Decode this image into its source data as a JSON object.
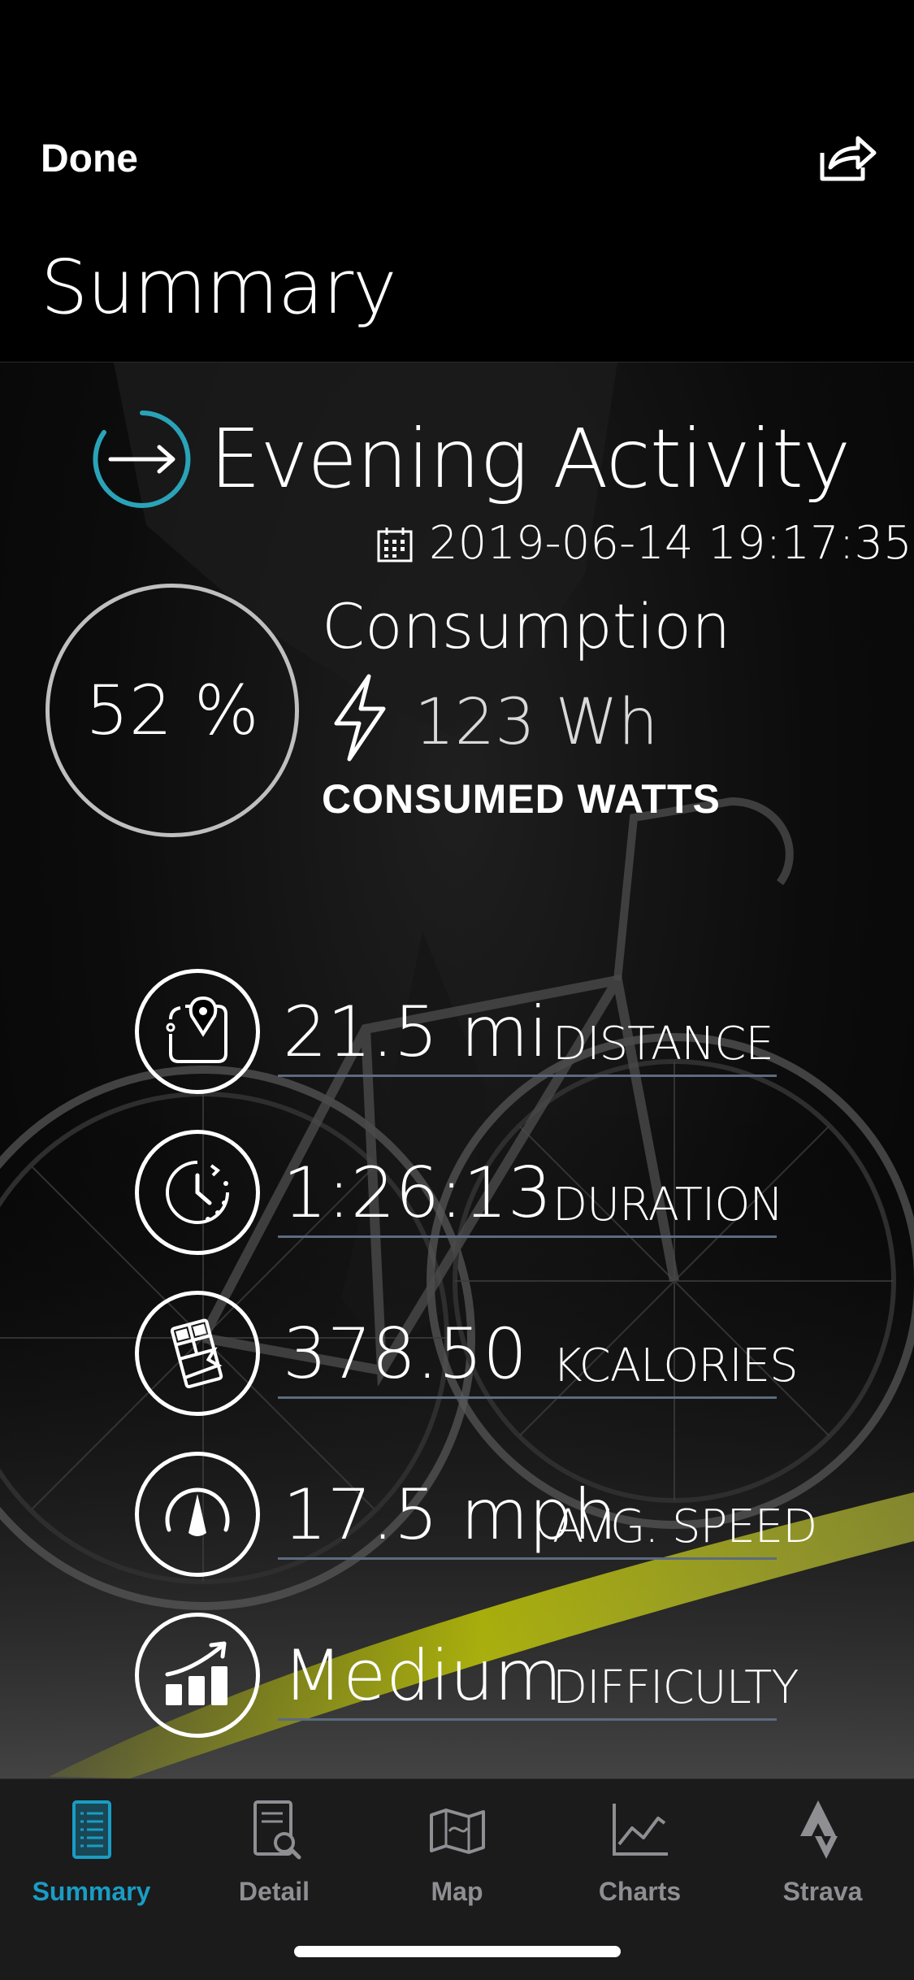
{
  "nav": {
    "done_label": "Done",
    "share_icon": "share-icon",
    "title": "Summary"
  },
  "activity": {
    "title": "Evening Activity",
    "date": "2019-06-14 19:17:35",
    "icon": "arrow-right-circle-icon"
  },
  "consumption": {
    "percent": "52 %",
    "label": "Consumption",
    "value": "123 Wh",
    "caption": "CONSUMED WATTS"
  },
  "stats": [
    {
      "value": "21.5 mi",
      "label": "DISTANCE",
      "icon": "map-pin-icon"
    },
    {
      "value": "1:26:13",
      "label": "DURATION",
      "icon": "stopwatch-icon"
    },
    {
      "value": "378.50",
      "label": "KCALORIES",
      "icon": "chocolate-bar-icon"
    },
    {
      "value": "17.5 mph",
      "label": "AVG. SPEED",
      "icon": "speedometer-icon"
    },
    {
      "value": "Medium",
      "label": "DIFFICULTY",
      "icon": "difficulty-chart-icon"
    }
  ],
  "tabs": [
    {
      "label": "Summary",
      "icon": "summary-list-icon",
      "active": true
    },
    {
      "label": "Detail",
      "icon": "detail-search-icon",
      "active": false
    },
    {
      "label": "Map",
      "icon": "map-icon",
      "active": false
    },
    {
      "label": "Charts",
      "icon": "line-chart-icon",
      "active": false
    },
    {
      "label": "Strava",
      "icon": "strava-icon",
      "active": false
    }
  ],
  "colors": {
    "accent": "#1a9cc4",
    "activity_ring": "#2aa3b8",
    "tab_inactive": "#8e8e93",
    "stat_underline": "#5c6b80",
    "highlight_yellow": "#d8e000"
  }
}
